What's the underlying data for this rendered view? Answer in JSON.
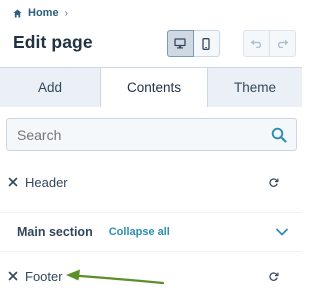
{
  "breadcrumb": {
    "home_label": "Home",
    "home_icon": "home-icon",
    "separator_icon": "chevron-right-icon"
  },
  "page": {
    "title": "Edit page"
  },
  "toolbar": {
    "desktop_icon": "desktop-icon",
    "mobile_icon": "mobile-icon",
    "undo_icon": "undo-icon",
    "redo_icon": "redo-icon",
    "desktop_selected": true
  },
  "tabs": [
    {
      "label": "Add",
      "selected": false
    },
    {
      "label": "Contents",
      "selected": true
    },
    {
      "label": "Theme",
      "selected": false
    }
  ],
  "search": {
    "placeholder": "Search",
    "icon": "search-icon"
  },
  "sections": {
    "header": {
      "label": "Header",
      "remove_icon": "close-icon",
      "sync_icon": "refresh-icon"
    },
    "main": {
      "label": "Main section",
      "collapse_label": "Collapse all",
      "toggle_icon": "chevron-down-icon"
    },
    "footer": {
      "label": "Footer",
      "remove_icon": "close-icon",
      "sync_icon": "refresh-icon"
    }
  },
  "colors": {
    "accent_link": "#2e8fb3",
    "annotation_arrow": "#5a8f29",
    "tab_inactive_bg": "#eaf0f6",
    "text": "#33475b"
  }
}
